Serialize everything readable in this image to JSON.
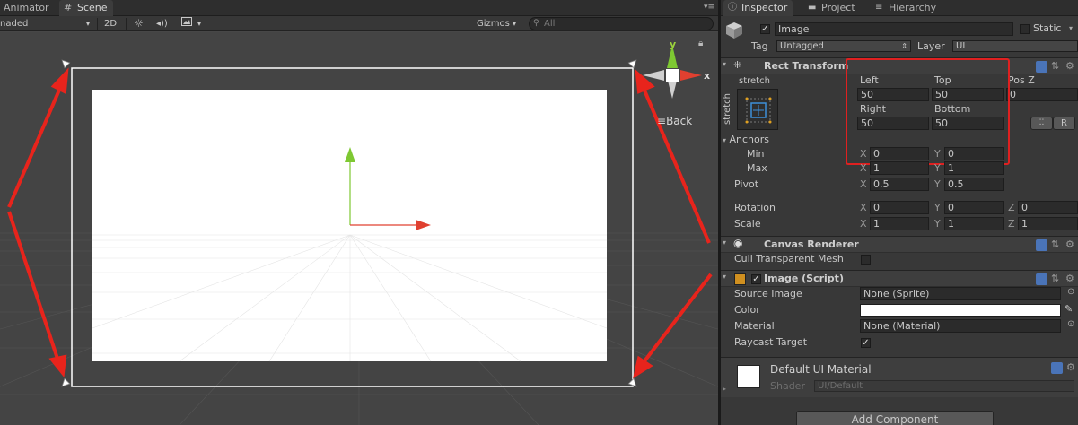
{
  "scene": {
    "tabs": [
      "Animator",
      "Scene"
    ],
    "active_tab": "Scene",
    "shading_mode": "naded",
    "mode_2d": "2D",
    "gizmos_label": "Gizmos",
    "search_placeholder": "All",
    "gizmo_axes": {
      "x": "x",
      "y": "y"
    },
    "view_label": "Back"
  },
  "inspector": {
    "tabs": [
      "Inspector",
      "Project",
      "Hierarchy"
    ],
    "object": {
      "name": "Image",
      "active": true,
      "static_label": "Static",
      "tag_label": "Tag",
      "tag_value": "Untagged",
      "layer_label": "Layer",
      "layer_value": "UI"
    },
    "rect_transform": {
      "title": "Rect Transform",
      "anchor_preset": "stretch",
      "left_label": "Left",
      "left": "50",
      "top_label": "Top",
      "top": "50",
      "posz_label": "Pos Z",
      "posz": "0",
      "right_label": "Right",
      "right": "50",
      "bottom_label": "Bottom",
      "bottom": "50",
      "raw_button": "R",
      "anchors_label": "Anchors",
      "min_label": "Min",
      "min_x": "0",
      "min_y": "0",
      "max_label": "Max",
      "max_x": "1",
      "max_y": "1",
      "pivot_label": "Pivot",
      "pivot_x": "0.5",
      "pivot_y": "0.5",
      "rotation_label": "Rotation",
      "rot_x": "0",
      "rot_y": "0",
      "rot_z": "0",
      "scale_label": "Scale",
      "scale_x": "1",
      "scale_y": "1",
      "scale_z": "1",
      "axis_x": "X",
      "axis_y": "Y",
      "axis_z": "Z"
    },
    "canvas_renderer": {
      "title": "Canvas Renderer",
      "cull_label": "Cull Transparent Mesh",
      "cull_checked": false
    },
    "image_script": {
      "title": "Image (Script)",
      "source_label": "Source Image",
      "source_value": "None (Sprite)",
      "color_label": "Color",
      "color_value": "#ffffff",
      "material_label": "Material",
      "material_value": "None (Material)",
      "raycast_label": "Raycast Target",
      "raycast_checked": true
    },
    "material": {
      "name": "Default UI Material",
      "shader_label": "Shader",
      "shader_value": "UI/Default"
    },
    "add_component": "Add Component"
  },
  "colors": {
    "highlight_box": "#e02020",
    "arrow": "#e8241c",
    "y_axis": "#7ec832",
    "x_axis": "#e04030"
  }
}
